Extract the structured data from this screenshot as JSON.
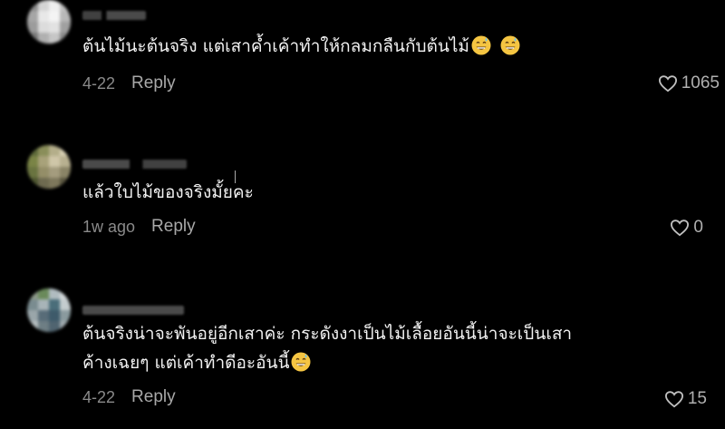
{
  "comments": [
    {
      "text_lines": [
        "ต้นไม้นะต้นจริง แต่เสาค้ำเค้าทำให้กลมกลืนกับต้นไม้"
      ],
      "emoji_count": 2,
      "date": "4-22",
      "reply_label": "Reply",
      "likes": "1065",
      "avatar_colors": [
        "#9a9a9a",
        "#c8c8c8",
        "#e6e6e6",
        "#b4b4b4"
      ]
    },
    {
      "text_lines": [
        "แล้วใบไม้ของจริงมั้ยคะ"
      ],
      "emoji_count": 0,
      "date": "1w ago",
      "reply_label": "Reply",
      "likes": "0",
      "avatar_colors": [
        "#6f7a4a",
        "#a6a07a",
        "#8c8a6a",
        "#d0c9b0"
      ]
    },
    {
      "text_lines": [
        "ต้นจริงน่าจะพันอยู่อีกเสาค่ะ กระดังงาเป็นไม้เลื้อยอันนี้น่าจะเป็นเสา",
        "ค้างเฉยๆ แต่เค้าทำดีอะอันนี้"
      ],
      "emoji_count": 1,
      "date": "4-22",
      "reply_label": "Reply",
      "likes": "15",
      "avatar_colors": [
        "#4a6e7a",
        "#9aa8b0",
        "#6c8a5a",
        "#c0c8cc"
      ]
    }
  ],
  "colors": {
    "background": "#000000",
    "text": "#f2f2f2",
    "meta": "#8a8a8a",
    "emoji": "#f5c542"
  },
  "icons": {
    "like": "heart-outline-icon",
    "emoji": "grinning-sweat-emoji-icon"
  }
}
